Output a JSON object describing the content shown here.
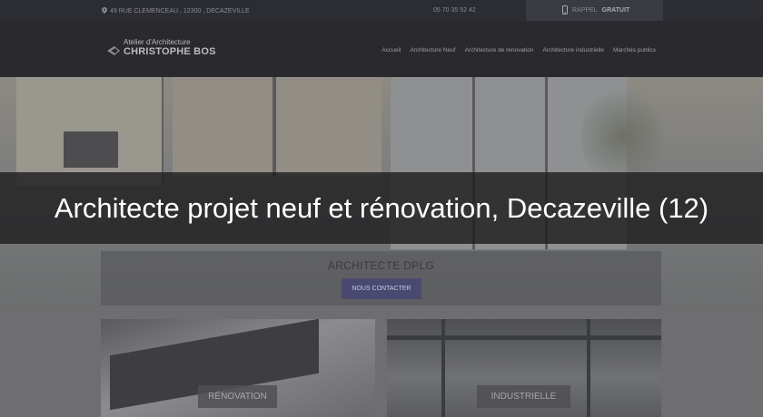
{
  "topbar": {
    "address": "49 RUE CLEMENCEAU , 12300 , DECAZEVILLE",
    "phone": "05 70 35 52 42",
    "callback_label": "RAPPEL",
    "callback_bold": "GRATUIT"
  },
  "logo": {
    "line1": "Atelier d'Architecture",
    "line2": "CHRISTOPHE BOS"
  },
  "nav": {
    "items": [
      "Accueil",
      "Architecture Neuf",
      "Architecture de rénovation",
      "Architecture industrielle",
      "Marchés publics"
    ]
  },
  "hero": {
    "title": "Architecte projet neuf et rénovation, Decazeville (12)",
    "subtitle": "ARCHITECTE DPLG",
    "cta": "NOUS CONTACTER"
  },
  "cards": [
    {
      "label": "RÉNOVATION"
    },
    {
      "label": "INDUSTRIELLE"
    }
  ],
  "colors": {
    "topbar_bg": "#2c2c33",
    "navbar_bg": "#2a2a2e",
    "cta_bg": "#4a4a70",
    "title_text": "#ffffff"
  }
}
